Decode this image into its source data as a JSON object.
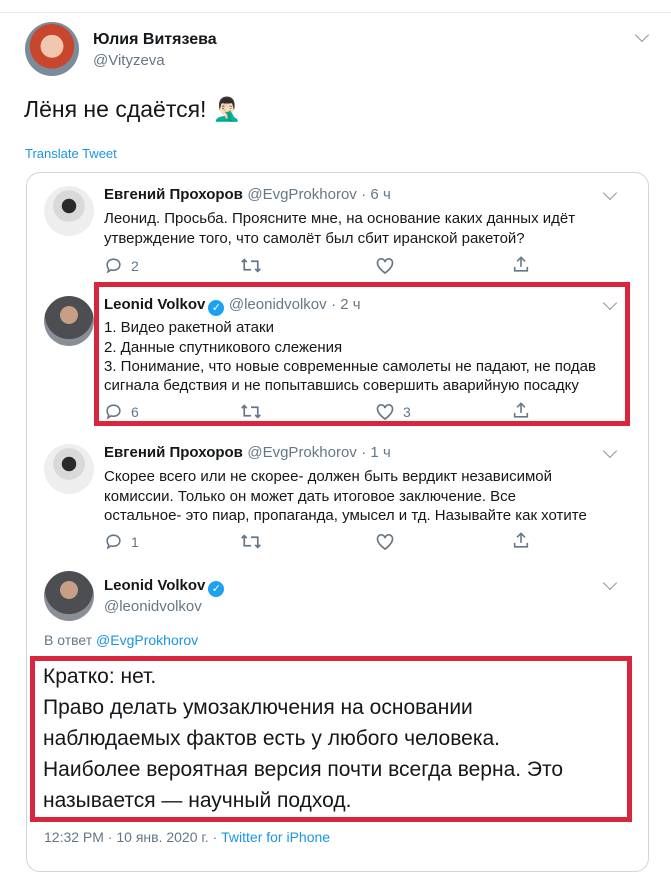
{
  "author": {
    "name": "Юлия Витязева",
    "handle": "@Vityzeva"
  },
  "tweet": {
    "text": "Лёня не сдаётся!",
    "emoji": "🤦🏻‍♂️",
    "translate": "Translate Tweet"
  },
  "thread": [
    {
      "name": "Евгений Прохоров",
      "handle": "@EvgProkhorov",
      "time": "· 6 ч",
      "lines": [
        "Леонид. Просьба. Проясните мне, на основание каких данных идёт",
        "утверждение того, что самолёт был сбит иранской ракетой?"
      ],
      "replies": "2",
      "likes": ""
    },
    {
      "name": "Leonid Volkov",
      "handle": "@leonidvolkov",
      "time": "· 2 ч",
      "lines": [
        "1. Видео ракетной атаки",
        "2. Данные спутникового слежения",
        "3. Понимание, что новые современные самолеты не падают, не подав",
        "сигнала бедствия и не попытавшись совершить аварийную посадку"
      ],
      "replies": "6",
      "likes": "3"
    },
    {
      "name": "Евгений Прохоров",
      "handle": "@EvgProkhorov",
      "time": "· 1 ч",
      "lines": [
        "Скорее всего или не скорее- должен быть вердикт независимой",
        "комиссии. Только он может дать итоговое заключение. Все",
        "остальное- это пиар, пропаганда, умысел и тд. Называйте как хотите"
      ],
      "replies": "1",
      "likes": ""
    }
  ],
  "main_reply": {
    "name": "Leonid Volkov",
    "handle": "@leonidvolkov",
    "reply_prefix": "В ответ",
    "reply_to": "@EvgProkhorov",
    "lines": [
      "Кратко: нет.",
      "Право делать умозаключения на основании",
      "наблюдаемых фактов есть у любого человека.",
      "Наиболее вероятная версия почти всегда верна. Это",
      "называется — научный подход."
    ],
    "time": "12:32 PM · 10 янв. 2020 г. · ",
    "source": "Twitter for iPhone"
  },
  "colors": {
    "accent": "#1da1f2",
    "highlight": "#d7263d",
    "secondary_text": "#657786"
  }
}
